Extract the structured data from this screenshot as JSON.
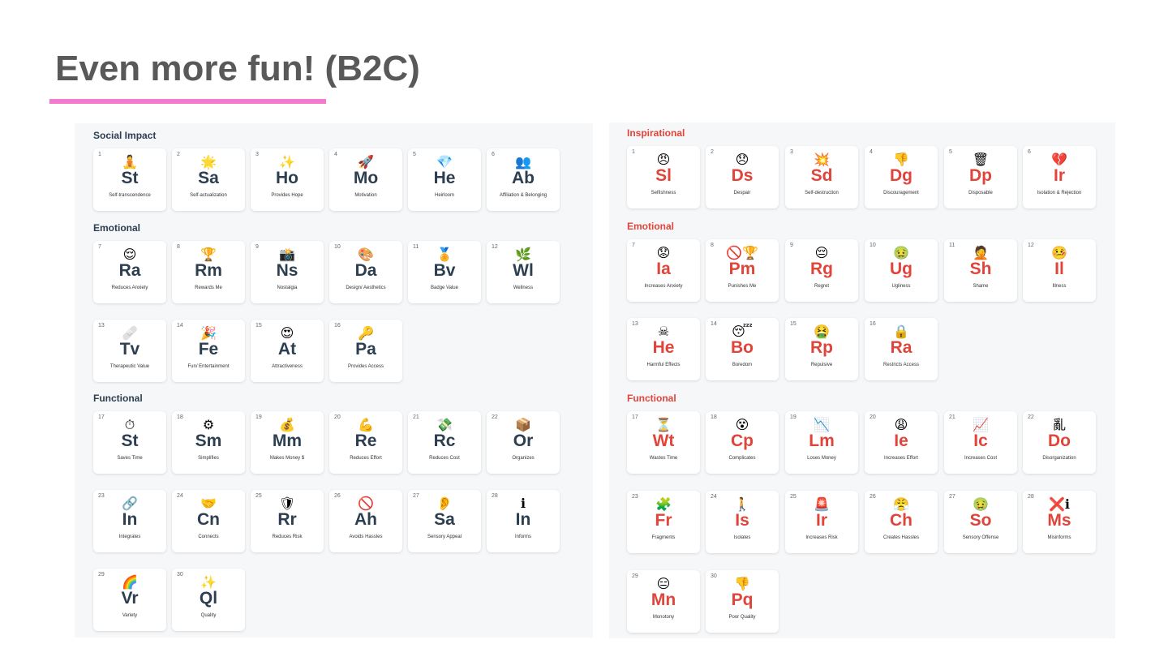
{
  "slide": {
    "title": "Even more fun! (B2C)",
    "accent_color": "#f47ad0"
  },
  "left": {
    "color": "#2c3e50",
    "sections": [
      "Social Impact",
      "Emotional",
      "Functional"
    ],
    "tiles": [
      {
        "num": "1",
        "icon": "🧘",
        "sym": "St",
        "name": "Self-transcendence"
      },
      {
        "num": "2",
        "icon": "🌟",
        "sym": "Sa",
        "name": "Self-actualization"
      },
      {
        "num": "3",
        "icon": "✨",
        "sym": "Ho",
        "name": "Provides Hope"
      },
      {
        "num": "4",
        "icon": "🚀",
        "sym": "Mo",
        "name": "Motivation"
      },
      {
        "num": "5",
        "icon": "💎",
        "sym": "He",
        "name": "Heirloom"
      },
      {
        "num": "6",
        "icon": "👥",
        "sym": "Ab",
        "name": "Affiliation & Belonging"
      },
      {
        "num": "7",
        "icon": "😌",
        "sym": "Ra",
        "name": "Reduces Anxiety"
      },
      {
        "num": "8",
        "icon": "🏆",
        "sym": "Rm",
        "name": "Rewards Me"
      },
      {
        "num": "9",
        "icon": "📸",
        "sym": "Ns",
        "name": "Nostalgia"
      },
      {
        "num": "10",
        "icon": "🎨",
        "sym": "Da",
        "name": "Design/ Aesthetics"
      },
      {
        "num": "11",
        "icon": "🏅",
        "sym": "Bv",
        "name": "Badge Value"
      },
      {
        "num": "12",
        "icon": "🌿",
        "sym": "Wl",
        "name": "Wellness"
      },
      {
        "num": "13",
        "icon": "🩹",
        "sym": "Tv",
        "name": "Therapeutic Value"
      },
      {
        "num": "14",
        "icon": "🎉",
        "sym": "Fe",
        "name": "Fun/ Entertainment"
      },
      {
        "num": "15",
        "icon": "😍",
        "sym": "At",
        "name": "Attractiveness"
      },
      {
        "num": "16",
        "icon": "🔑",
        "sym": "Pa",
        "name": "Provides Access"
      },
      {
        "num": "17",
        "icon": "⏱",
        "sym": "St",
        "name": "Saves Time"
      },
      {
        "num": "18",
        "icon": "⚙",
        "sym": "Sm",
        "name": "Simplifies"
      },
      {
        "num": "19",
        "icon": "💰",
        "sym": "Mm",
        "name": "Makes Money $"
      },
      {
        "num": "20",
        "icon": "💪",
        "sym": "Re",
        "name": "Reduces Effort"
      },
      {
        "num": "21",
        "icon": "💸",
        "sym": "Rc",
        "name": "Reduces Cost"
      },
      {
        "num": "22",
        "icon": "📦",
        "sym": "Or",
        "name": "Organizes"
      },
      {
        "num": "23",
        "icon": "🔗",
        "sym": "In",
        "name": "Integrates"
      },
      {
        "num": "24",
        "icon": "🤝",
        "sym": "Cn",
        "name": "Connects"
      },
      {
        "num": "25",
        "icon": "🛡",
        "sym": "Rr",
        "name": "Reduces Risk"
      },
      {
        "num": "26",
        "icon": "🚫",
        "sym": "Ah",
        "name": "Avoids Hassles"
      },
      {
        "num": "27",
        "icon": "👂",
        "sym": "Sa",
        "name": "Sensory Appeal"
      },
      {
        "num": "28",
        "icon": "ℹ",
        "sym": "In",
        "name": "Informs"
      },
      {
        "num": "29",
        "icon": "🌈",
        "sym": "Vr",
        "name": "Variety"
      },
      {
        "num": "30",
        "icon": "✨",
        "sym": "Ql",
        "name": "Quality"
      }
    ]
  },
  "right": {
    "color": "#e0443a",
    "sections": [
      "Inspirational",
      "Emotional",
      "Functional"
    ],
    "tiles": [
      {
        "num": "1",
        "icon": "😠",
        "sym": "Sl",
        "name": "Selfishness"
      },
      {
        "num": "2",
        "icon": "😞",
        "sym": "Ds",
        "name": "Despair"
      },
      {
        "num": "3",
        "icon": "💥",
        "sym": "Sd",
        "name": "Self-destruction"
      },
      {
        "num": "4",
        "icon": "👎",
        "sym": "Dg",
        "name": "Discouragement"
      },
      {
        "num": "5",
        "icon": "🗑",
        "sym": "Dp",
        "name": "Disposable"
      },
      {
        "num": "6",
        "icon": "💔",
        "sym": "Ir",
        "name": "Isolation & Rejection"
      },
      {
        "num": "7",
        "icon": "😟",
        "sym": "Ia",
        "name": "Increases Anxiety"
      },
      {
        "num": "8",
        "icon": "🚫🏆",
        "sym": "Pm",
        "name": "Punishes Me"
      },
      {
        "num": "9",
        "icon": "😔",
        "sym": "Rg",
        "name": "Regret"
      },
      {
        "num": "10",
        "icon": "🤢",
        "sym": "Ug",
        "name": "Ugliness"
      },
      {
        "num": "11",
        "icon": "🤦",
        "sym": "Sh",
        "name": "Shame"
      },
      {
        "num": "12",
        "icon": "🤒",
        "sym": "Il",
        "name": "Illness"
      },
      {
        "num": "13",
        "icon": "☠",
        "sym": "He",
        "name": "Harmful Effects"
      },
      {
        "num": "14",
        "icon": "😴",
        "sym": "Bo",
        "name": "Boredom"
      },
      {
        "num": "15",
        "icon": "🤮",
        "sym": "Rp",
        "name": "Repulsive"
      },
      {
        "num": "16",
        "icon": "🔒",
        "sym": "Ra",
        "name": "Restricts Access"
      },
      {
        "num": "17",
        "icon": "⏳",
        "sym": "Wt",
        "name": "Wastes Time"
      },
      {
        "num": "18",
        "icon": "😵",
        "sym": "Cp",
        "name": "Complicates"
      },
      {
        "num": "19",
        "icon": "📉",
        "sym": "Lm",
        "name": "Loses Money"
      },
      {
        "num": "20",
        "icon": "😩",
        "sym": "Ie",
        "name": "Increases Effort"
      },
      {
        "num": "21",
        "icon": "📈",
        "sym": "Ic",
        "name": "Increases Cost"
      },
      {
        "num": "22",
        "icon": "亂",
        "sym": "Do",
        "name": "Disorganization"
      },
      {
        "num": "23",
        "icon": "🧩",
        "sym": "Fr",
        "name": "Fragments"
      },
      {
        "num": "24",
        "icon": "🚶",
        "sym": "Is",
        "name": "Isolates"
      },
      {
        "num": "25",
        "icon": "🚨",
        "sym": "Ir",
        "name": "Increases Risk"
      },
      {
        "num": "26",
        "icon": "😤",
        "sym": "Ch",
        "name": "Creates Hassles"
      },
      {
        "num": "27",
        "icon": "🤢",
        "sym": "So",
        "name": "Sensory Offense"
      },
      {
        "num": "28",
        "icon": "❌ℹ",
        "sym": "Ms",
        "name": "Misinforms"
      },
      {
        "num": "29",
        "icon": "😑",
        "sym": "Mn",
        "name": "Monotony"
      },
      {
        "num": "30",
        "icon": "👎",
        "sym": "Pq",
        "name": "Poor Quality"
      }
    ]
  }
}
